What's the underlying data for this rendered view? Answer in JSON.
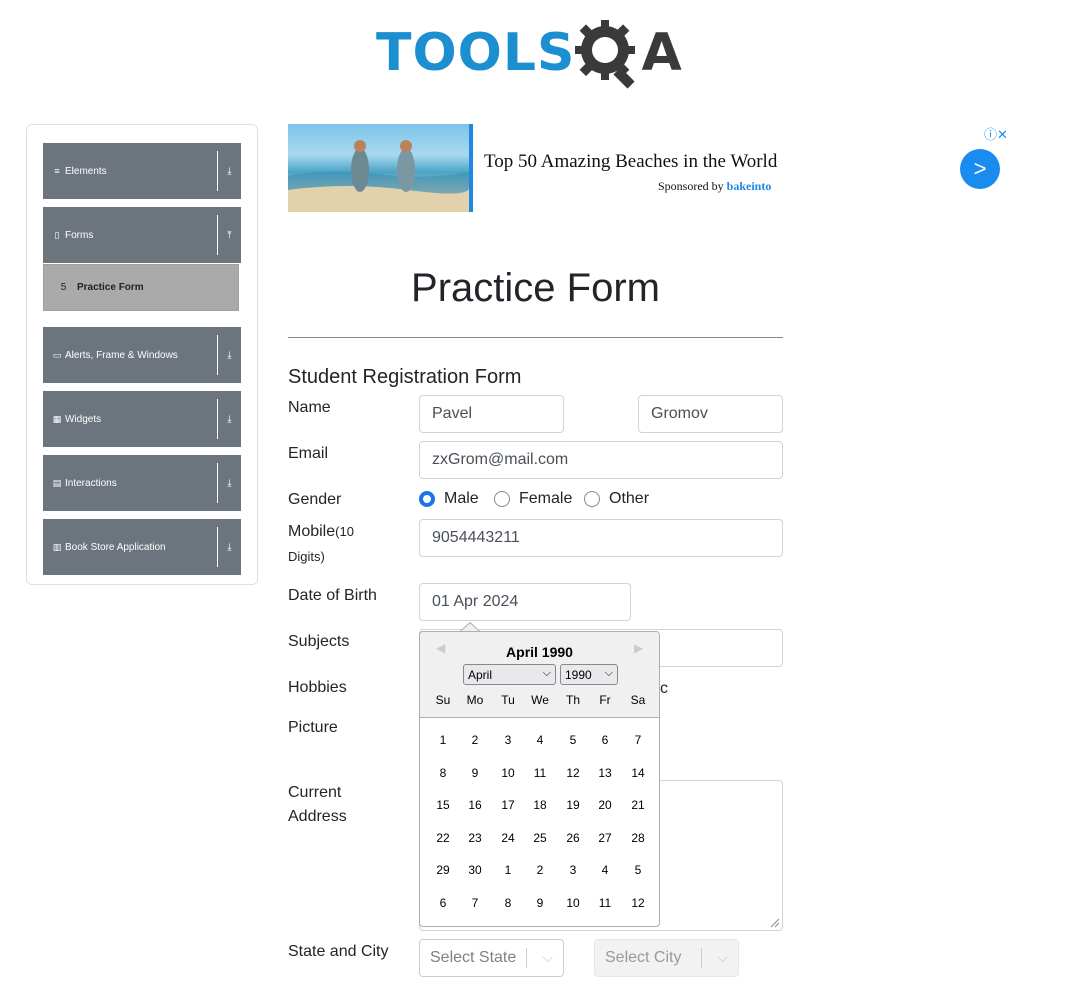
{
  "logo": {
    "text": "TOOLSQA"
  },
  "sidebar": {
    "groups": [
      {
        "label": "Elements",
        "icon": "list-icon",
        "arrow": "⤓"
      },
      {
        "label": "Forms",
        "icon": "form-icon",
        "arrow": "⤒"
      },
      {
        "label": "Alerts, Frame & Windows",
        "icon": "window-icon",
        "arrow": "⤓"
      },
      {
        "label": "Widgets",
        "icon": "grid-icon",
        "arrow": "⤓"
      },
      {
        "label": "Interactions",
        "icon": "interaction-icon",
        "arrow": "⤓"
      },
      {
        "label": "Book Store Application",
        "icon": "books-icon",
        "arrow": "⤓"
      }
    ],
    "active_item": "Practice Form"
  },
  "ad": {
    "title": "Top 50 Amazing Beaches in the World",
    "sponsored_prefix": "Sponsored by",
    "sponsor": "bakeinto",
    "cta": ">",
    "info": "ⓘ✕"
  },
  "form": {
    "page_title": "Practice Form",
    "subtitle": "Student Registration Form",
    "name_label": "Name",
    "first_name": "Pavel",
    "last_name": "Gromov",
    "email_label": "Email",
    "email": "zxGrom@mail.com",
    "gender_label": "Gender",
    "gender_options": [
      "Male",
      "Female",
      "Other"
    ],
    "gender_selected": "Male",
    "mobile_label": "Mobile",
    "mobile_hint": "(10",
    "mobile_hint2": "Digits)",
    "mobile": "9054443211",
    "dob_label": "Date of Birth",
    "dob": "01 Apr 2024",
    "subjects_label": "Subjects",
    "hobbies_label": "Hobbies",
    "hobbies_partial": "c",
    "picture_label": "Picture",
    "address_label_1": "Current",
    "address_label_2": "Address",
    "state_city_label": "State and City",
    "state_placeholder": "Select State",
    "city_placeholder": "Select City"
  },
  "datepicker": {
    "header": "April 1990",
    "month_select": "April",
    "year_select": "1990",
    "day_names": [
      "Su",
      "Mo",
      "Tu",
      "We",
      "Th",
      "Fr",
      "Sa"
    ],
    "weeks": [
      [
        "1",
        "2",
        "3",
        "4",
        "5",
        "6",
        "7"
      ],
      [
        "8",
        "9",
        "10",
        "11",
        "12",
        "13",
        "14"
      ],
      [
        "15",
        "16",
        "17",
        "18",
        "19",
        "20",
        "21"
      ],
      [
        "22",
        "23",
        "24",
        "25",
        "26",
        "27",
        "28"
      ],
      [
        "29",
        "30",
        "1",
        "2",
        "3",
        "4",
        "5"
      ],
      [
        "6",
        "7",
        "8",
        "9",
        "10",
        "11",
        "12"
      ]
    ]
  }
}
